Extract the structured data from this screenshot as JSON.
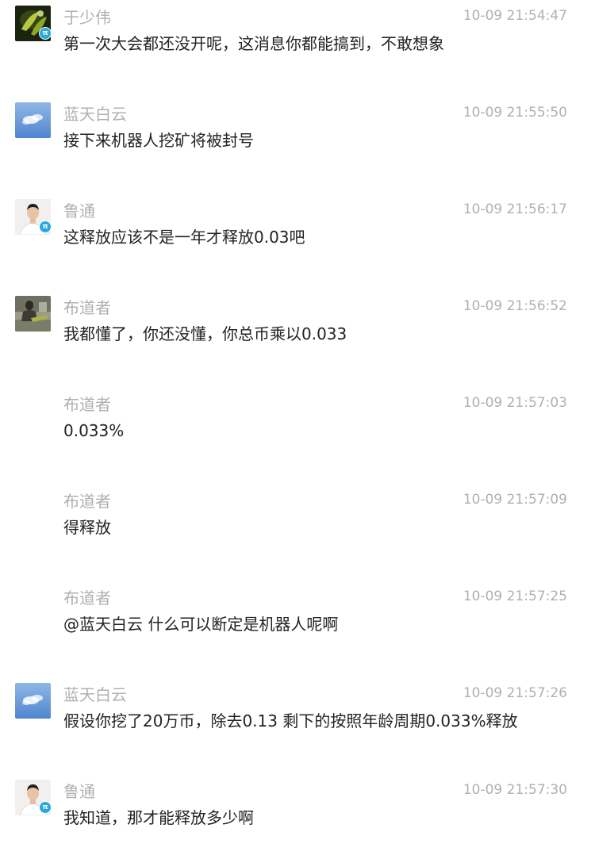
{
  "messages": [
    {
      "sender": "于少伟",
      "time": "10-09 21:54:47",
      "text": "第一次大会都还没开呢，这消息你都能搞到，不敢想象",
      "avatar": "dark-green-plant-avatar",
      "badge": "π"
    },
    {
      "sender": "蓝天白云",
      "time": "10-09 21:55:50",
      "text": "接下来机器人挖矿将被封号",
      "avatar": "blue-sky-clouds-avatar",
      "badge": ""
    },
    {
      "sender": "鲁通",
      "time": "10-09 21:56:17",
      "text": "这释放应该不是一年才释放0.03吧",
      "avatar": "man-portrait-avatar",
      "badge": "π"
    },
    {
      "sender": "布道者",
      "time": "10-09 21:56:52",
      "text": "我都懂了，你还没懂，你总币乘以0.033",
      "avatar": "seated-person-photo-avatar",
      "badge": ""
    },
    {
      "sender": "布道者",
      "time": "10-09 21:57:03",
      "text": "0.033%",
      "avatar": "",
      "badge": ""
    },
    {
      "sender": "布道者",
      "time": "10-09 21:57:09",
      "text": "得释放",
      "avatar": "",
      "badge": ""
    },
    {
      "sender": "布道者",
      "time": "10-09 21:57:25",
      "text": "@蓝天白云 什么可以断定是机器人呢啊",
      "avatar": "",
      "badge": ""
    },
    {
      "sender": "蓝天白云",
      "time": "10-09 21:57:26",
      "text": "假设你挖了20万币，除去0.13 剩下的按照年龄周期0.033%释放",
      "avatar": "blue-sky-clouds-avatar",
      "badge": ""
    },
    {
      "sender": "鲁通",
      "time": "10-09 21:57:30",
      "text": "我知道，那才能释放多少啊",
      "avatar": "man-portrait-avatar",
      "badge": "π"
    }
  ],
  "colors": {
    "meta_text": "#b0b0b0",
    "body_text": "#222222",
    "badge": "#29a8e0",
    "background": "#ffffff"
  }
}
